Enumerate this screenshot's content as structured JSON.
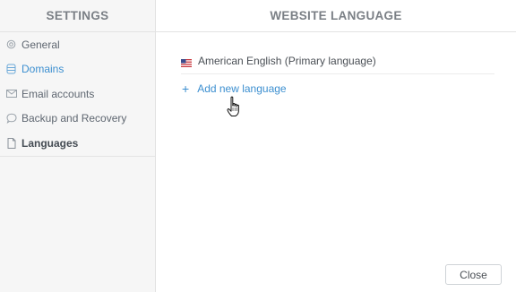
{
  "sidebar": {
    "title": "SETTINGS",
    "items": [
      {
        "label": "General",
        "icon": "gear-icon"
      },
      {
        "label": "Domains",
        "icon": "database-icon"
      },
      {
        "label": "Email accounts",
        "icon": "envelope-icon"
      },
      {
        "label": "Backup and Recovery",
        "icon": "speech-bubble-icon"
      },
      {
        "label": "Languages",
        "icon": "document-icon"
      }
    ]
  },
  "main": {
    "title": "WEBSITE LANGUAGE",
    "languages": [
      {
        "label": "American English (Primary language)",
        "icon": "us-flag-icon"
      }
    ],
    "add_label": "Add new language"
  },
  "footer": {
    "close_label": "Close"
  },
  "colors": {
    "accent": "#3c8fd0",
    "sidebar_bg": "#f6f6f6",
    "header_text": "#7a7f85"
  }
}
